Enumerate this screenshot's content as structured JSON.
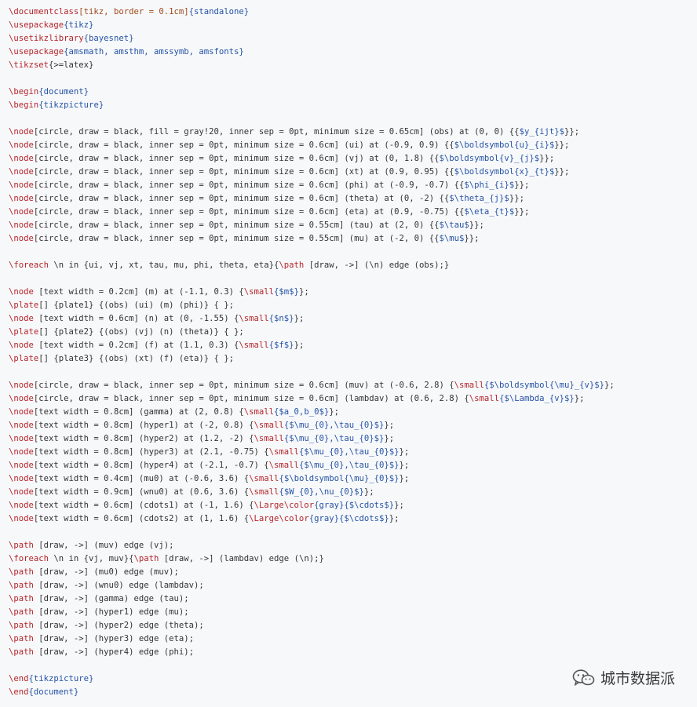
{
  "code_lines": [
    [
      {
        "t": "\\documentclass",
        "c": "kw"
      },
      {
        "t": "[tikz, border = 0.1cm]",
        "c": "optarg"
      },
      {
        "t": "{standalone}",
        "c": "arg"
      }
    ],
    [
      {
        "t": "\\usepackage",
        "c": "kw"
      },
      {
        "t": "{tikz}",
        "c": "arg"
      }
    ],
    [
      {
        "t": "\\usetikzlibrary",
        "c": "kw"
      },
      {
        "t": "{bayesnet}",
        "c": "arg"
      }
    ],
    [
      {
        "t": "\\usepackage",
        "c": "kw"
      },
      {
        "t": "{amsmath, amsthm, amssymb, amsfonts}",
        "c": "arg"
      }
    ],
    [
      {
        "t": "\\tikzset",
        "c": "kw"
      },
      {
        "t": "{>=latex}",
        "c": ""
      }
    ],
    [],
    [
      {
        "t": "\\begin",
        "c": "kw"
      },
      {
        "t": "{document}",
        "c": "arg"
      }
    ],
    [
      {
        "t": "\\begin",
        "c": "kw"
      },
      {
        "t": "{tikzpicture}",
        "c": "arg"
      }
    ],
    [],
    [
      {
        "t": "\\node",
        "c": "kw"
      },
      {
        "t": "[circle, draw = black, fill = gray!20, inner sep = 0pt, minimum size = 0.65cm] (obs) at (0, 0) {{",
        "c": ""
      },
      {
        "t": "$y_{ijt}$",
        "c": "arg"
      },
      {
        "t": "}};",
        "c": ""
      }
    ],
    [
      {
        "t": "\\node",
        "c": "kw"
      },
      {
        "t": "[circle, draw = black, inner sep = 0pt, minimum size = 0.6cm] (ui) at (-0.9, 0.9) {{",
        "c": ""
      },
      {
        "t": "$\\boldsymbol{u}_{i}$",
        "c": "arg"
      },
      {
        "t": "}};",
        "c": ""
      }
    ],
    [
      {
        "t": "\\node",
        "c": "kw"
      },
      {
        "t": "[circle, draw = black, inner sep = 0pt, minimum size = 0.6cm] (vj) at (0, 1.8) {{",
        "c": ""
      },
      {
        "t": "$\\boldsymbol{v}_{j}$",
        "c": "arg"
      },
      {
        "t": "}};",
        "c": ""
      }
    ],
    [
      {
        "t": "\\node",
        "c": "kw"
      },
      {
        "t": "[circle, draw = black, inner sep = 0pt, minimum size = 0.6cm] (xt) at (0.9, 0.95) {{",
        "c": ""
      },
      {
        "t": "$\\boldsymbol{x}_{t}$",
        "c": "arg"
      },
      {
        "t": "}};",
        "c": ""
      }
    ],
    [
      {
        "t": "\\node",
        "c": "kw"
      },
      {
        "t": "[circle, draw = black, inner sep = 0pt, minimum size = 0.6cm] (phi) at (-0.9, -0.7) {{",
        "c": ""
      },
      {
        "t": "$\\phi_{i}$",
        "c": "arg"
      },
      {
        "t": "}};",
        "c": ""
      }
    ],
    [
      {
        "t": "\\node",
        "c": "kw"
      },
      {
        "t": "[circle, draw = black, inner sep = 0pt, minimum size = 0.6cm] (theta) at (0, -2) {{",
        "c": ""
      },
      {
        "t": "$\\theta_{j}$",
        "c": "arg"
      },
      {
        "t": "}};",
        "c": ""
      }
    ],
    [
      {
        "t": "\\node",
        "c": "kw"
      },
      {
        "t": "[circle, draw = black, inner sep = 0pt, minimum size = 0.6cm] (eta) at (0.9, -0.75) {{",
        "c": ""
      },
      {
        "t": "$\\eta_{t}$",
        "c": "arg"
      },
      {
        "t": "}};",
        "c": ""
      }
    ],
    [
      {
        "t": "\\node",
        "c": "kw"
      },
      {
        "t": "[circle, draw = black, inner sep = 0pt, minimum size = 0.55cm] (tau) at (2, 0) {{",
        "c": ""
      },
      {
        "t": "$\\tau$",
        "c": "arg"
      },
      {
        "t": "}};",
        "c": ""
      }
    ],
    [
      {
        "t": "\\node",
        "c": "kw"
      },
      {
        "t": "[circle, draw = black, inner sep = 0pt, minimum size = 0.55cm] (mu) at (-2, 0) {{",
        "c": ""
      },
      {
        "t": "$\\mu$",
        "c": "arg"
      },
      {
        "t": "}};",
        "c": ""
      }
    ],
    [],
    [
      {
        "t": "\\foreach",
        "c": "kw"
      },
      {
        "t": " \\n in {ui, vj, xt, tau, mu, phi, theta, eta}{",
        "c": ""
      },
      {
        "t": "\\path",
        "c": "kw"
      },
      {
        "t": " [draw, ->] (\\n) edge (obs);}",
        "c": ""
      }
    ],
    [],
    [
      {
        "t": "\\node",
        "c": "kw"
      },
      {
        "t": " [text width = 0.2cm] (m) at (-1.1, 0.3) {",
        "c": ""
      },
      {
        "t": "\\small",
        "c": "kw"
      },
      {
        "t": "{$m$}",
        "c": "arg"
      },
      {
        "t": "};",
        "c": ""
      }
    ],
    [
      {
        "t": "\\plate",
        "c": "kw"
      },
      {
        "t": "[] {plate1} {(obs) (ui) (m) (phi)} { };",
        "c": ""
      }
    ],
    [
      {
        "t": "\\node",
        "c": "kw"
      },
      {
        "t": " [text width = 0.6cm] (n) at (0, -1.55) {",
        "c": ""
      },
      {
        "t": "\\small",
        "c": "kw"
      },
      {
        "t": "{$n$}",
        "c": "arg"
      },
      {
        "t": "};",
        "c": ""
      }
    ],
    [
      {
        "t": "\\plate",
        "c": "kw"
      },
      {
        "t": "[] {plate2} {(obs) (vj) (n) (theta)} { };",
        "c": ""
      }
    ],
    [
      {
        "t": "\\node",
        "c": "kw"
      },
      {
        "t": " [text width = 0.2cm] (f) at (1.1, 0.3) {",
        "c": ""
      },
      {
        "t": "\\small",
        "c": "kw"
      },
      {
        "t": "{$f$}",
        "c": "arg"
      },
      {
        "t": "};",
        "c": ""
      }
    ],
    [
      {
        "t": "\\plate",
        "c": "kw"
      },
      {
        "t": "[] {plate3} {(obs) (xt) (f) (eta)} { };",
        "c": ""
      }
    ],
    [],
    [
      {
        "t": "\\node",
        "c": "kw"
      },
      {
        "t": "[circle, draw = black, inner sep = 0pt, minimum size = 0.6cm] (muv) at (-0.6, 2.8) {",
        "c": ""
      },
      {
        "t": "\\small",
        "c": "kw"
      },
      {
        "t": "{$\\boldsymbol{\\mu}_{v}$}",
        "c": "arg"
      },
      {
        "t": "};",
        "c": ""
      }
    ],
    [
      {
        "t": "\\node",
        "c": "kw"
      },
      {
        "t": "[circle, draw = black, inner sep = 0pt, minimum size = 0.6cm] (lambdav) at (0.6, 2.8) {",
        "c": ""
      },
      {
        "t": "\\small",
        "c": "kw"
      },
      {
        "t": "{$\\Lambda_{v}$}",
        "c": "arg"
      },
      {
        "t": "};",
        "c": ""
      }
    ],
    [
      {
        "t": "\\node",
        "c": "kw"
      },
      {
        "t": "[text width = 0.8cm] (gamma) at (2, 0.8) {",
        "c": ""
      },
      {
        "t": "\\small",
        "c": "kw"
      },
      {
        "t": "{$a_0,b_0$}",
        "c": "arg"
      },
      {
        "t": "};",
        "c": ""
      }
    ],
    [
      {
        "t": "\\node",
        "c": "kw"
      },
      {
        "t": "[text width = 0.8cm] (hyper1) at (-2, 0.8) {",
        "c": ""
      },
      {
        "t": "\\small",
        "c": "kw"
      },
      {
        "t": "{$\\mu_{0},\\tau_{0}$}",
        "c": "arg"
      },
      {
        "t": "};",
        "c": ""
      }
    ],
    [
      {
        "t": "\\node",
        "c": "kw"
      },
      {
        "t": "[text width = 0.8cm] (hyper2) at (1.2, -2) {",
        "c": ""
      },
      {
        "t": "\\small",
        "c": "kw"
      },
      {
        "t": "{$\\mu_{0},\\tau_{0}$}",
        "c": "arg"
      },
      {
        "t": "};",
        "c": ""
      }
    ],
    [
      {
        "t": "\\node",
        "c": "kw"
      },
      {
        "t": "[text width = 0.8cm] (hyper3) at (2.1, -0.75) {",
        "c": ""
      },
      {
        "t": "\\small",
        "c": "kw"
      },
      {
        "t": "{$\\mu_{0},\\tau_{0}$}",
        "c": "arg"
      },
      {
        "t": "};",
        "c": ""
      }
    ],
    [
      {
        "t": "\\node",
        "c": "kw"
      },
      {
        "t": "[text width = 0.8cm] (hyper4) at (-2.1, -0.7) {",
        "c": ""
      },
      {
        "t": "\\small",
        "c": "kw"
      },
      {
        "t": "{$\\mu_{0},\\tau_{0}$}",
        "c": "arg"
      },
      {
        "t": "};",
        "c": ""
      }
    ],
    [
      {
        "t": "\\node",
        "c": "kw"
      },
      {
        "t": "[text width = 0.4cm] (mu0) at (-0.6, 3.6) {",
        "c": ""
      },
      {
        "t": "\\small",
        "c": "kw"
      },
      {
        "t": "{$\\boldsymbol{\\mu}_{0}$}",
        "c": "arg"
      },
      {
        "t": "};",
        "c": ""
      }
    ],
    [
      {
        "t": "\\node",
        "c": "kw"
      },
      {
        "t": "[text width = 0.9cm] (wnu0) at (0.6, 3.6) {",
        "c": ""
      },
      {
        "t": "\\small",
        "c": "kw"
      },
      {
        "t": "{$W_{0},\\nu_{0}$}",
        "c": "arg"
      },
      {
        "t": "};",
        "c": ""
      }
    ],
    [
      {
        "t": "\\node",
        "c": "kw"
      },
      {
        "t": "[text width = 0.6cm] (cdots1) at (-1, 1.6) {",
        "c": ""
      },
      {
        "t": "\\Large\\color",
        "c": "kw"
      },
      {
        "t": "{gray}{$\\cdots$}",
        "c": "arg"
      },
      {
        "t": "};",
        "c": ""
      }
    ],
    [
      {
        "t": "\\node",
        "c": "kw"
      },
      {
        "t": "[text width = 0.6cm] (cdots2) at (1, 1.6) {",
        "c": ""
      },
      {
        "t": "\\Large\\color",
        "c": "kw"
      },
      {
        "t": "{gray}{$\\cdots$}",
        "c": "arg"
      },
      {
        "t": "};",
        "c": ""
      }
    ],
    [],
    [
      {
        "t": "\\path",
        "c": "kw"
      },
      {
        "t": " [draw, ->] (muv) edge (vj);",
        "c": ""
      }
    ],
    [
      {
        "t": "\\foreach",
        "c": "kw"
      },
      {
        "t": " \\n in {vj, muv}{",
        "c": ""
      },
      {
        "t": "\\path",
        "c": "kw"
      },
      {
        "t": " [draw, ->] (lambdav) edge (\\n);}",
        "c": ""
      }
    ],
    [
      {
        "t": "\\path",
        "c": "kw"
      },
      {
        "t": " [draw, ->] (mu0) edge (muv);",
        "c": ""
      }
    ],
    [
      {
        "t": "\\path",
        "c": "kw"
      },
      {
        "t": " [draw, ->] (wnu0) edge (lambdav);",
        "c": ""
      }
    ],
    [
      {
        "t": "\\path",
        "c": "kw"
      },
      {
        "t": " [draw, ->] (gamma) edge (tau);",
        "c": ""
      }
    ],
    [
      {
        "t": "\\path",
        "c": "kw"
      },
      {
        "t": " [draw, ->] (hyper1) edge (mu);",
        "c": ""
      }
    ],
    [
      {
        "t": "\\path",
        "c": "kw"
      },
      {
        "t": " [draw, ->] (hyper2) edge (theta);",
        "c": ""
      }
    ],
    [
      {
        "t": "\\path",
        "c": "kw"
      },
      {
        "t": " [draw, ->] (hyper3) edge (eta);",
        "c": ""
      }
    ],
    [
      {
        "t": "\\path",
        "c": "kw"
      },
      {
        "t": " [draw, ->] (hyper4) edge (phi);",
        "c": ""
      }
    ],
    [],
    [
      {
        "t": "\\end",
        "c": "kw"
      },
      {
        "t": "{tikzpicture}",
        "c": "arg"
      }
    ],
    [
      {
        "t": "\\end",
        "c": "kw"
      },
      {
        "t": "{document}",
        "c": "arg"
      }
    ]
  ],
  "watermark": {
    "icon": "wechat-icon",
    "text": "城市数据派"
  },
  "colors": {
    "background": "#f7f8fa",
    "keyword": "#b5262b",
    "argument": "#2553a5",
    "option": "#a04a1a",
    "text": "#333333"
  }
}
